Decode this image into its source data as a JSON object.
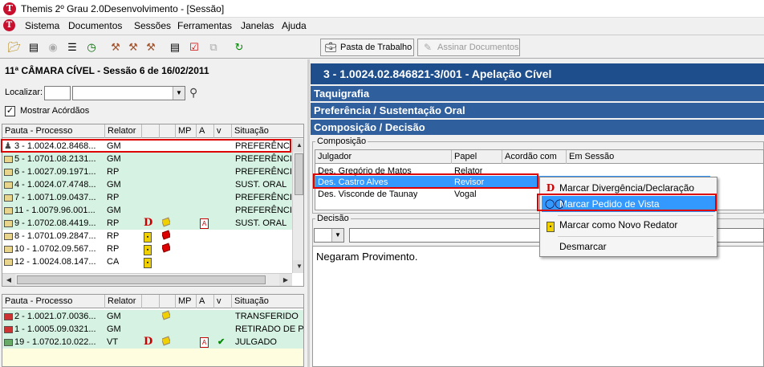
{
  "window": {
    "title": "Themis 2º Grau 2.0Desenvolvimento - [Sessão]",
    "logo_letter": "T"
  },
  "menu": [
    "Sistema",
    "Documentos",
    "Sessões",
    "Ferramentas",
    "Janelas",
    "Ajuda"
  ],
  "toolbar": {
    "pasta_label": "Pasta de Trabalho",
    "assinar_label": "Assinar Documentos"
  },
  "left": {
    "header": "11ª  CÂMARA CÍVEL - Sessão 6 de 16/02/2011",
    "localizar_label": "Localizar:",
    "mostrar_label": "Mostrar Acórdãos",
    "columns": [
      "Pauta - Processo",
      "Relator",
      "",
      "",
      "MP",
      "A",
      "v",
      "Situação"
    ],
    "rows1": [
      {
        "proc": "3 - 1.0024.02.8468...",
        "rel": "GM",
        "sit": "PREFERÊNCI"
      },
      {
        "proc": "5 - 1.0701.08.2131...",
        "rel": "GM",
        "sit": "PREFERÊNCI"
      },
      {
        "proc": "6 - 1.0027.09.1971...",
        "rel": "RP",
        "sit": "PREFERÊNCI"
      },
      {
        "proc": "4 - 1.0024.07.4748...",
        "rel": "GM",
        "sit": "SUST. ORAL"
      },
      {
        "proc": "7 - 1.0071.09.0437...",
        "rel": "RP",
        "sit": "PREFERÊNCI"
      },
      {
        "proc": "11 - 1.0079.96.001...",
        "rel": "GM",
        "sit": "PREFERÊNCI"
      },
      {
        "proc": "9 - 1.0702.08.4419...",
        "rel": "RP",
        "sit": "SUST. ORAL"
      },
      {
        "proc": "8 - 1.0701.09.2847...",
        "rel": "RP",
        "sit": ""
      },
      {
        "proc": "10 - 1.0702.09.567...",
        "rel": "RP",
        "sit": ""
      },
      {
        "proc": "12 - 1.0024.08.147...",
        "rel": "CA",
        "sit": ""
      }
    ],
    "rows2": [
      {
        "proc": "2 - 1.0021.07.0036...",
        "rel": "GM",
        "sit": "TRANSFERIDO"
      },
      {
        "proc": "1 - 1.0005.09.0321...",
        "rel": "GM",
        "sit": "RETIRADO DE PA"
      },
      {
        "proc": "19 - 1.0702.10.022...",
        "rel": "VT",
        "sit": "JULGADO"
      }
    ]
  },
  "right": {
    "title": "3  -  1.0024.02.846821-3/001 - Apelação Cível",
    "sections": [
      "Taquigrafia",
      "Preferência / Sustentação Oral",
      "Composição / Decisão"
    ],
    "composicao_label": "Composição",
    "comp_columns": [
      "Julgador",
      "Papel",
      "Acordão com",
      "Em Sessão"
    ],
    "comp_rows": [
      {
        "julgador": "Des. Gregório de Matos",
        "papel": "Relator"
      },
      {
        "julgador": "Des. Castro Alves",
        "papel": "Revisor"
      },
      {
        "julgador": "Des. Visconde de Taunay",
        "papel": "Vogal"
      }
    ],
    "decisao_label": "Decisão",
    "decisao_text": "Negaram Provimento."
  },
  "context_menu": [
    "Marcar Divergência/Declaração",
    "Marcar Pedido de Vista",
    "Marcar como Novo Redator",
    "Desmarcar"
  ],
  "colors": {
    "title_bar": "#1f4e8c",
    "section_bar": "#2f5f9d",
    "row_green": "#d6f2e3",
    "selection": "#3399ff",
    "highlight_box": "#dd0000"
  }
}
